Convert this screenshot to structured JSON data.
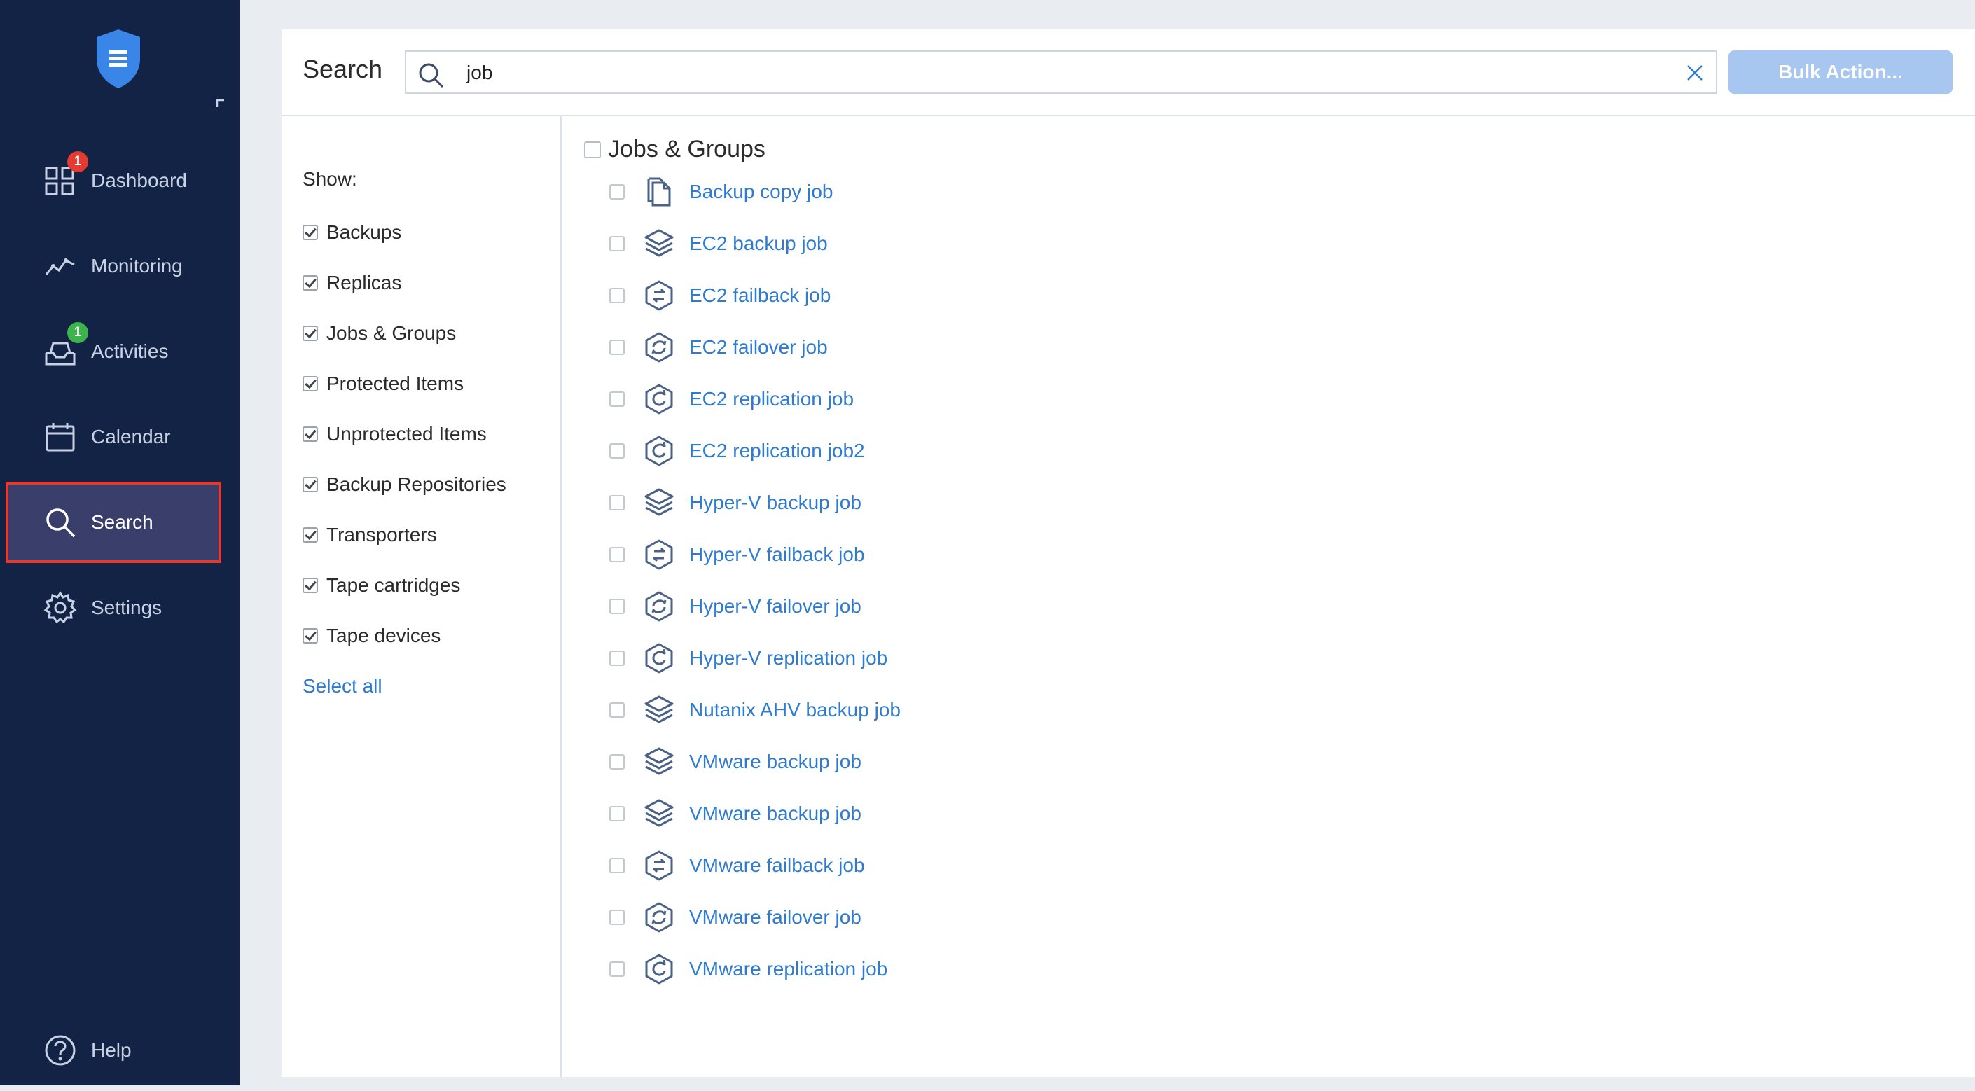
{
  "sidebar": {
    "items": [
      {
        "label": "Dashboard",
        "icon": "dashboard-grid-icon",
        "badge": "1",
        "badge_color": "#e53a2f"
      },
      {
        "label": "Monitoring",
        "icon": "monitoring-chart-icon"
      },
      {
        "label": "Activities",
        "icon": "activities-inbox-icon",
        "badge": "1",
        "badge_color": "#3cb44b"
      },
      {
        "label": "Calendar",
        "icon": "calendar-icon"
      },
      {
        "label": "Search",
        "icon": "search-icon",
        "active": true
      },
      {
        "label": "Settings",
        "icon": "gear-icon"
      }
    ],
    "help_label": "Help"
  },
  "search": {
    "title": "Search",
    "query": "job",
    "bulk_action_label": "Bulk Action..."
  },
  "filters": {
    "show_label": "Show:",
    "items": [
      {
        "label": "Backups",
        "checked": true
      },
      {
        "label": "Replicas",
        "checked": true
      },
      {
        "label": "Jobs & Groups",
        "checked": true
      },
      {
        "label": "Protected Items",
        "checked": true
      },
      {
        "label": "Unprotected Items",
        "checked": true
      },
      {
        "label": "Backup Repositories",
        "checked": true
      },
      {
        "label": "Transporters",
        "checked": true
      },
      {
        "label": "Tape cartridges",
        "checked": true
      },
      {
        "label": "Tape devices",
        "checked": true
      }
    ],
    "select_all_label": "Select all"
  },
  "results": {
    "group_title": "Jobs & Groups",
    "items": [
      {
        "label": "Backup copy job",
        "icon": "backup-copy-icon"
      },
      {
        "label": "EC2 backup job",
        "icon": "backup-layers-icon"
      },
      {
        "label": "EC2 failback job",
        "icon": "failback-icon"
      },
      {
        "label": "EC2 failover job",
        "icon": "failover-icon"
      },
      {
        "label": "EC2 replication job",
        "icon": "replication-icon"
      },
      {
        "label": "EC2 replication job2",
        "icon": "replication-icon"
      },
      {
        "label": "Hyper-V backup job",
        "icon": "backup-layers-icon"
      },
      {
        "label": "Hyper-V failback job",
        "icon": "failback-icon"
      },
      {
        "label": "Hyper-V failover job",
        "icon": "failover-icon"
      },
      {
        "label": "Hyper-V replication job",
        "icon": "replication-icon"
      },
      {
        "label": "Nutanix AHV backup job",
        "icon": "backup-layers-icon"
      },
      {
        "label": "VMware backup job",
        "icon": "backup-layers-icon"
      },
      {
        "label": "VMware backup job",
        "icon": "backup-layers-icon"
      },
      {
        "label": "VMware failback job",
        "icon": "failback-icon"
      },
      {
        "label": "VMware failover job",
        "icon": "failover-icon"
      },
      {
        "label": "VMware replication job",
        "icon": "replication-icon"
      }
    ]
  },
  "colors": {
    "sidebar_bg": "#122346",
    "accent_link": "#2e7bd0",
    "active_outline": "#e53a2f",
    "bulk_button": "#a7c7f0"
  }
}
